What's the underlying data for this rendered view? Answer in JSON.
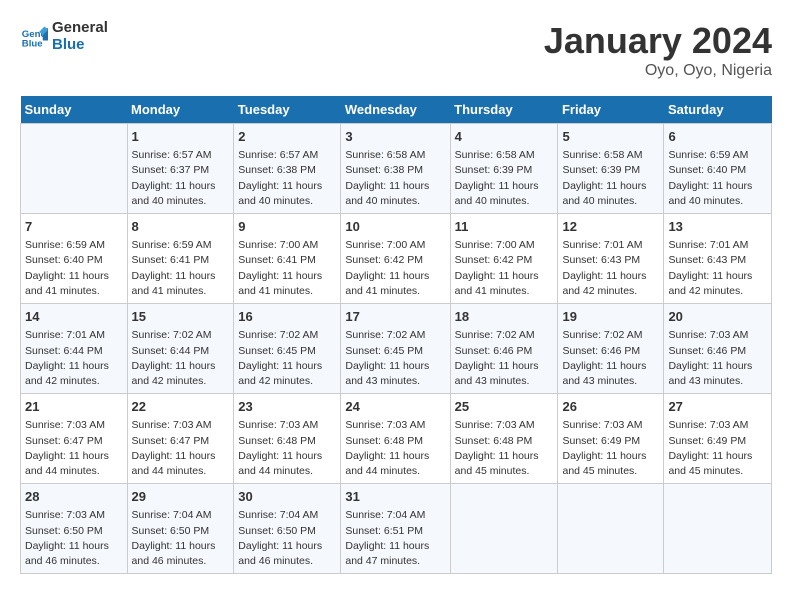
{
  "header": {
    "logo_line1": "General",
    "logo_line2": "Blue",
    "main_title": "January 2024",
    "sub_title": "Oyo, Oyo, Nigeria"
  },
  "columns": [
    "Sunday",
    "Monday",
    "Tuesday",
    "Wednesday",
    "Thursday",
    "Friday",
    "Saturday"
  ],
  "weeks": [
    [
      {
        "day": "",
        "info": ""
      },
      {
        "day": "1",
        "info": "Sunrise: 6:57 AM\nSunset: 6:37 PM\nDaylight: 11 hours\nand 40 minutes."
      },
      {
        "day": "2",
        "info": "Sunrise: 6:57 AM\nSunset: 6:38 PM\nDaylight: 11 hours\nand 40 minutes."
      },
      {
        "day": "3",
        "info": "Sunrise: 6:58 AM\nSunset: 6:38 PM\nDaylight: 11 hours\nand 40 minutes."
      },
      {
        "day": "4",
        "info": "Sunrise: 6:58 AM\nSunset: 6:39 PM\nDaylight: 11 hours\nand 40 minutes."
      },
      {
        "day": "5",
        "info": "Sunrise: 6:58 AM\nSunset: 6:39 PM\nDaylight: 11 hours\nand 40 minutes."
      },
      {
        "day": "6",
        "info": "Sunrise: 6:59 AM\nSunset: 6:40 PM\nDaylight: 11 hours\nand 40 minutes."
      }
    ],
    [
      {
        "day": "7",
        "info": "Sunrise: 6:59 AM\nSunset: 6:40 PM\nDaylight: 11 hours\nand 41 minutes."
      },
      {
        "day": "8",
        "info": "Sunrise: 6:59 AM\nSunset: 6:41 PM\nDaylight: 11 hours\nand 41 minutes."
      },
      {
        "day": "9",
        "info": "Sunrise: 7:00 AM\nSunset: 6:41 PM\nDaylight: 11 hours\nand 41 minutes."
      },
      {
        "day": "10",
        "info": "Sunrise: 7:00 AM\nSunset: 6:42 PM\nDaylight: 11 hours\nand 41 minutes."
      },
      {
        "day": "11",
        "info": "Sunrise: 7:00 AM\nSunset: 6:42 PM\nDaylight: 11 hours\nand 41 minutes."
      },
      {
        "day": "12",
        "info": "Sunrise: 7:01 AM\nSunset: 6:43 PM\nDaylight: 11 hours\nand 42 minutes."
      },
      {
        "day": "13",
        "info": "Sunrise: 7:01 AM\nSunset: 6:43 PM\nDaylight: 11 hours\nand 42 minutes."
      }
    ],
    [
      {
        "day": "14",
        "info": "Sunrise: 7:01 AM\nSunset: 6:44 PM\nDaylight: 11 hours\nand 42 minutes."
      },
      {
        "day": "15",
        "info": "Sunrise: 7:02 AM\nSunset: 6:44 PM\nDaylight: 11 hours\nand 42 minutes."
      },
      {
        "day": "16",
        "info": "Sunrise: 7:02 AM\nSunset: 6:45 PM\nDaylight: 11 hours\nand 42 minutes."
      },
      {
        "day": "17",
        "info": "Sunrise: 7:02 AM\nSunset: 6:45 PM\nDaylight: 11 hours\nand 43 minutes."
      },
      {
        "day": "18",
        "info": "Sunrise: 7:02 AM\nSunset: 6:46 PM\nDaylight: 11 hours\nand 43 minutes."
      },
      {
        "day": "19",
        "info": "Sunrise: 7:02 AM\nSunset: 6:46 PM\nDaylight: 11 hours\nand 43 minutes."
      },
      {
        "day": "20",
        "info": "Sunrise: 7:03 AM\nSunset: 6:46 PM\nDaylight: 11 hours\nand 43 minutes."
      }
    ],
    [
      {
        "day": "21",
        "info": "Sunrise: 7:03 AM\nSunset: 6:47 PM\nDaylight: 11 hours\nand 44 minutes."
      },
      {
        "day": "22",
        "info": "Sunrise: 7:03 AM\nSunset: 6:47 PM\nDaylight: 11 hours\nand 44 minutes."
      },
      {
        "day": "23",
        "info": "Sunrise: 7:03 AM\nSunset: 6:48 PM\nDaylight: 11 hours\nand 44 minutes."
      },
      {
        "day": "24",
        "info": "Sunrise: 7:03 AM\nSunset: 6:48 PM\nDaylight: 11 hours\nand 44 minutes."
      },
      {
        "day": "25",
        "info": "Sunrise: 7:03 AM\nSunset: 6:48 PM\nDaylight: 11 hours\nand 45 minutes."
      },
      {
        "day": "26",
        "info": "Sunrise: 7:03 AM\nSunset: 6:49 PM\nDaylight: 11 hours\nand 45 minutes."
      },
      {
        "day": "27",
        "info": "Sunrise: 7:03 AM\nSunset: 6:49 PM\nDaylight: 11 hours\nand 45 minutes."
      }
    ],
    [
      {
        "day": "28",
        "info": "Sunrise: 7:03 AM\nSunset: 6:50 PM\nDaylight: 11 hours\nand 46 minutes."
      },
      {
        "day": "29",
        "info": "Sunrise: 7:04 AM\nSunset: 6:50 PM\nDaylight: 11 hours\nand 46 minutes."
      },
      {
        "day": "30",
        "info": "Sunrise: 7:04 AM\nSunset: 6:50 PM\nDaylight: 11 hours\nand 46 minutes."
      },
      {
        "day": "31",
        "info": "Sunrise: 7:04 AM\nSunset: 6:51 PM\nDaylight: 11 hours\nand 47 minutes."
      },
      {
        "day": "",
        "info": ""
      },
      {
        "day": "",
        "info": ""
      },
      {
        "day": "",
        "info": ""
      }
    ]
  ]
}
